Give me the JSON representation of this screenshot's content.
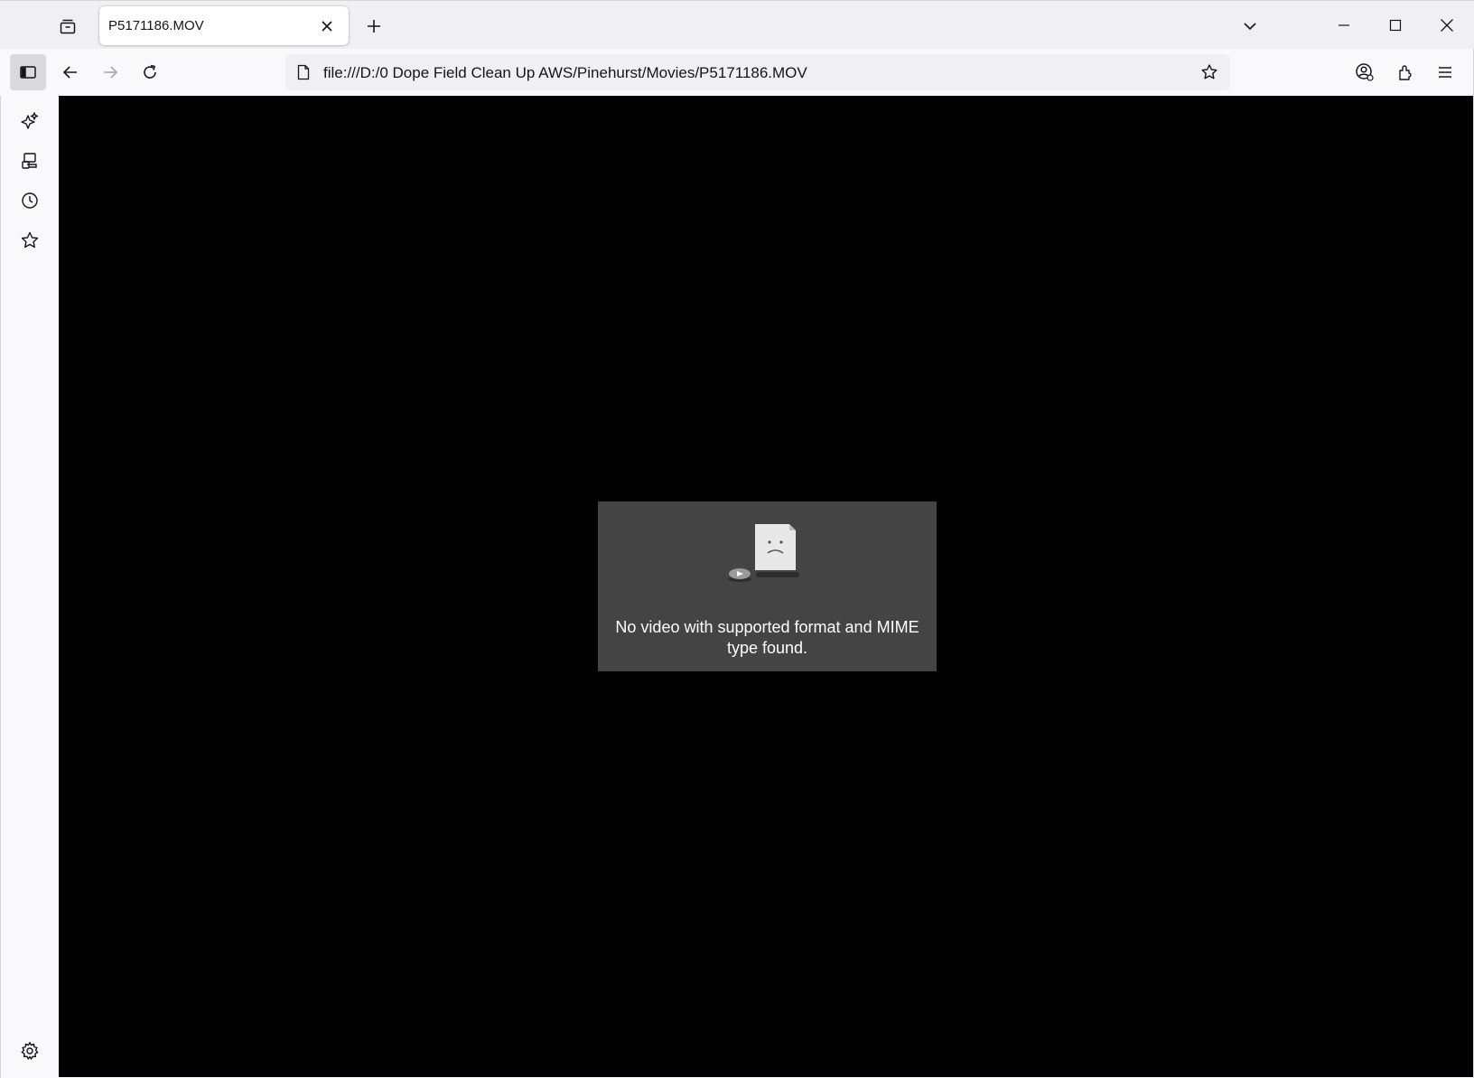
{
  "tab": {
    "title": "P5171186.MOV"
  },
  "navigation": {
    "url": "file:///D:/0 Dope Field Clean Up AWS/Pinehurst/Movies/P5171186.MOV"
  },
  "video_error": {
    "message_line1": "No video with supported format and MIME",
    "message_line2": "type found."
  },
  "icons": {
    "titlebar": [
      "tab-groups-icon",
      "close-tab-icon",
      "new-tab-icon",
      "tab-list-icon",
      "minimize-icon",
      "maximize-icon",
      "close-window-icon"
    ],
    "toolbar": [
      "sidebar-toggle-icon",
      "back-icon",
      "forward-icon",
      "reload-icon",
      "page-icon",
      "bookmark-star-icon",
      "account-icon",
      "extensions-icon",
      "menu-icon"
    ],
    "sidebar": [
      "ai-chatbot-icon",
      "synced-tabs-icon",
      "history-icon",
      "bookmarks-icon",
      "settings-icon"
    ]
  },
  "colors": {
    "content_background": "#000000",
    "error_box": "#444444",
    "chrome_background": "#f0f0f4",
    "sidebar_active": "#d9d9de"
  }
}
